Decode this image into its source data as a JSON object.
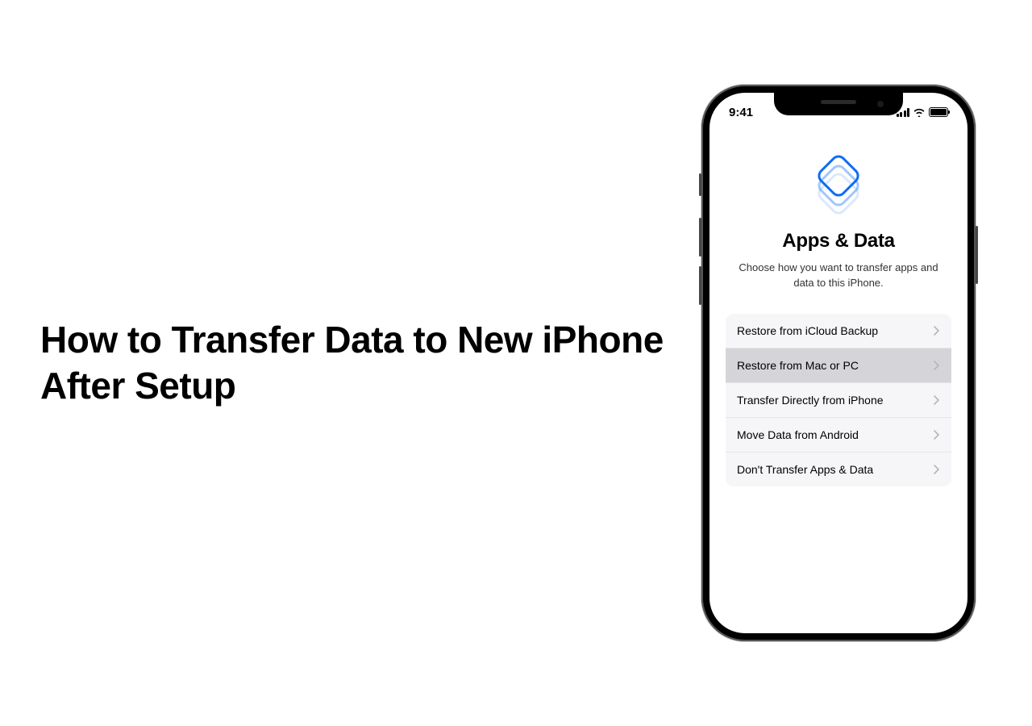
{
  "headline": "How to Transfer Data to New iPhone After Setup",
  "phone": {
    "status_time": "9:41",
    "screen_title": "Apps & Data",
    "screen_subtitle": "Choose how you want to transfer apps and data to this iPhone.",
    "options": [
      {
        "label": "Restore from iCloud Backup",
        "selected": false
      },
      {
        "label": "Restore from Mac or PC",
        "selected": true
      },
      {
        "label": "Transfer Directly from iPhone",
        "selected": false
      },
      {
        "label": "Move Data from Android",
        "selected": false
      },
      {
        "label": "Don't Transfer Apps & Data",
        "selected": false
      }
    ]
  }
}
